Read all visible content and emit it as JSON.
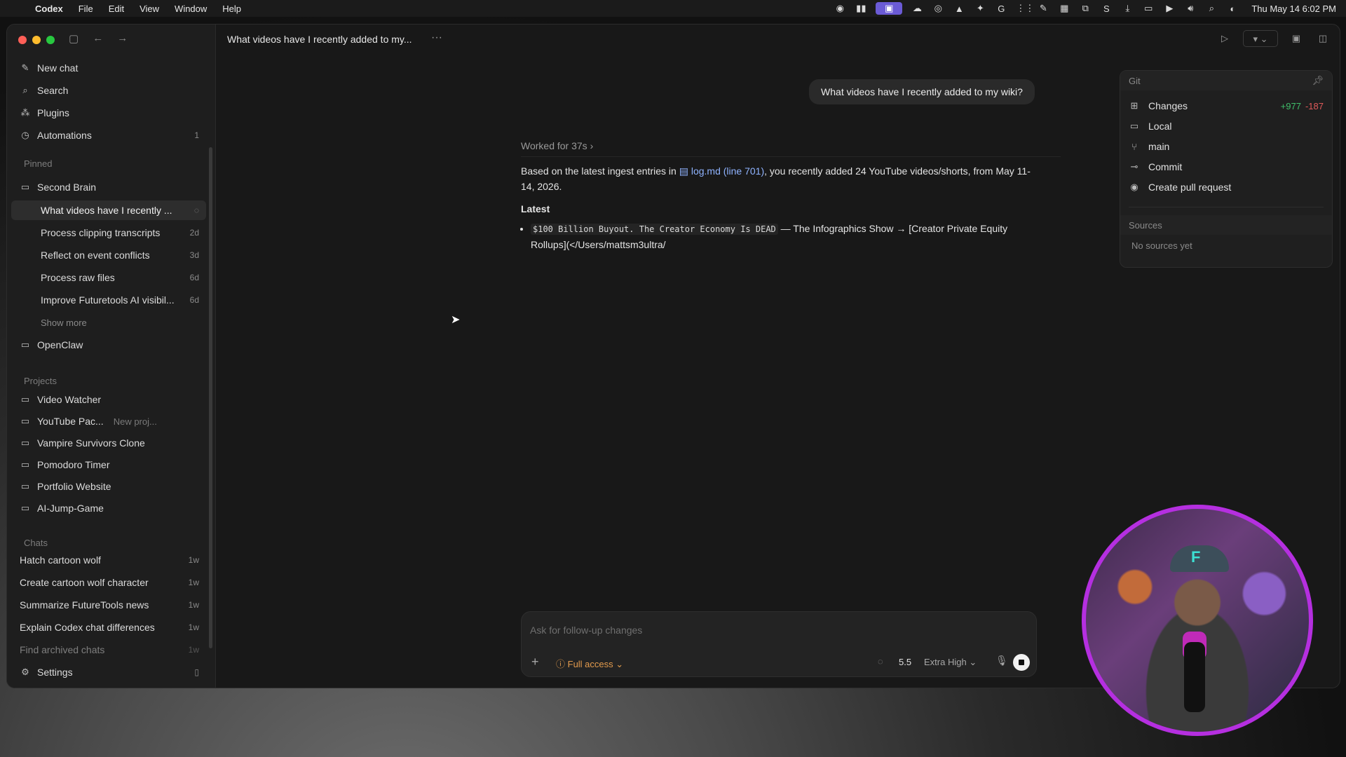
{
  "menubar": {
    "app_name": "Codex",
    "menus": [
      "File",
      "Edit",
      "View",
      "Window",
      "Help"
    ],
    "clock": "Thu May 14  6:02 PM"
  },
  "sidebar": {
    "top": [
      {
        "label": "New chat",
        "icon": "compose-icon"
      },
      {
        "label": "Search",
        "icon": "search-icon"
      },
      {
        "label": "Plugins",
        "icon": "plugins-icon"
      },
      {
        "label": "Automations",
        "icon": "clock-icon",
        "badge": "1"
      }
    ],
    "pinned_header": "Pinned",
    "pinned_folder": "Second Brain",
    "pinned_items": [
      {
        "label": "What videos have I recently ...",
        "meta": ""
      },
      {
        "label": "Process clipping transcripts",
        "meta": "2d"
      },
      {
        "label": "Reflect on event conflicts",
        "meta": "3d"
      },
      {
        "label": "Process raw files",
        "meta": "6d"
      },
      {
        "label": "Improve Futuretools AI visibil...",
        "meta": "6d"
      }
    ],
    "show_more": "Show more",
    "pinned_folder_2": "OpenClaw",
    "projects_header": "Projects",
    "projects": [
      {
        "label": "Video Watcher",
        "sub": ""
      },
      {
        "label": "YouTube Pac...",
        "sub": "New proj..."
      },
      {
        "label": "Vampire Survivors Clone",
        "sub": ""
      },
      {
        "label": "Pomodoro Timer",
        "sub": ""
      },
      {
        "label": "Portfolio Website",
        "sub": ""
      },
      {
        "label": "AI-Jump-Game",
        "sub": ""
      }
    ],
    "chats_header": "Chats",
    "chats": [
      {
        "label": "Hatch cartoon wolf",
        "meta": "1w"
      },
      {
        "label": "Create cartoon wolf character",
        "meta": "1w"
      },
      {
        "label": "Summarize FutureTools news",
        "meta": "1w"
      },
      {
        "label": "Explain Codex chat differences",
        "meta": "1w"
      },
      {
        "label": "Find archived chats",
        "meta": "1w"
      }
    ],
    "settings": "Settings"
  },
  "topbar": {
    "title": "What videos have I recently added to my...",
    "more": "···"
  },
  "conversation": {
    "user_message": "What videos have I recently added to my wiki?",
    "worked": "Worked for 37s",
    "answer_pre": "Based on the latest ingest entries in ",
    "answer_link": "log.md (line 701)",
    "answer_post": ", you recently added 24 YouTube videos/shorts, from May 11-14, 2026.",
    "heading": "Latest",
    "bullet_code": "$100 Billion Buyout. The Creator Economy Is DEAD",
    "bullet_text": " — The Infographics Show → [Creator Private Equity Rollups](</Users/mattsm3ultra/"
  },
  "git_panel": {
    "header": "Git",
    "rows": [
      {
        "label": "Changes",
        "icon": "diff-icon"
      },
      {
        "label": "Local",
        "icon": "laptop-icon"
      },
      {
        "label": "main",
        "icon": "branch-icon"
      },
      {
        "label": "Commit",
        "icon": "commit-icon"
      },
      {
        "label": "Create pull request",
        "icon": "github-icon"
      }
    ],
    "additions": "+977",
    "deletions": "-187",
    "sources_header": "Sources",
    "sources_empty": "No sources yet"
  },
  "composer": {
    "placeholder": "Ask for follow-up changes",
    "access": "Full access",
    "model": "5.5",
    "effort": "Extra High"
  },
  "colors": {
    "accent_link": "#8fb3ff",
    "access_orange": "#e39b4d",
    "add_green": "#3fbf6a",
    "del_red": "#e05a5a",
    "webcam_ring": "#b52fe0"
  }
}
